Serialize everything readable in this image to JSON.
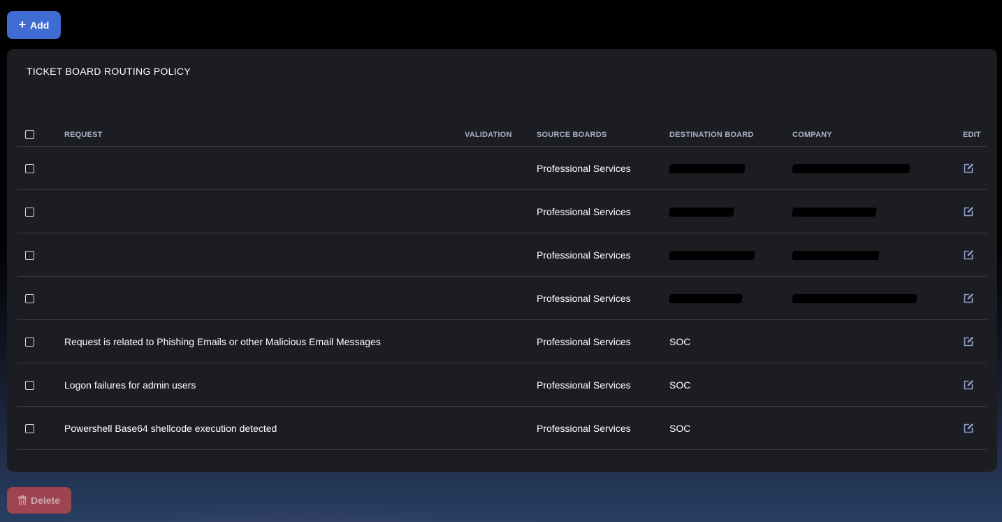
{
  "toolbar": {
    "add_label": "Add",
    "add_icon": "plus-icon",
    "delete_label": "Delete",
    "delete_icon": "trash-icon"
  },
  "panel": {
    "title": "TICKET BOARD ROUTING POLICY"
  },
  "table": {
    "headers": {
      "request": "REQUEST",
      "validation": "VALIDATION",
      "source_boards": "SOURCE BOARDS",
      "destination_board": "DESTINATION BOARD",
      "company": "COMPANY",
      "edit": "EDIT"
    },
    "rows": [
      {
        "request": "",
        "validation": "",
        "source_boards": "Professional Services",
        "destination_board": "",
        "company": "",
        "destination_redacted": true,
        "company_redacted": true
      },
      {
        "request": "",
        "validation": "",
        "source_boards": "Professional Services",
        "destination_board": "",
        "company": "",
        "destination_redacted": true,
        "company_redacted": true
      },
      {
        "request": "",
        "validation": "",
        "source_boards": "Professional Services",
        "destination_board": "",
        "company": "",
        "destination_redacted": true,
        "company_redacted": true
      },
      {
        "request": "",
        "validation": "",
        "source_boards": "Professional Services",
        "destination_board": "",
        "company": "",
        "destination_redacted": true,
        "company_redacted": true
      },
      {
        "request": "Request is related to Phishing Emails or other Malicious Email Messages",
        "validation": "",
        "source_boards": "Professional Services",
        "destination_board": "SOC",
        "company": ""
      },
      {
        "request": "Logon failures for admin users",
        "validation": "",
        "source_boards": "Professional Services",
        "destination_board": "SOC",
        "company": ""
      },
      {
        "request": "Powershell Base64 shellcode execution detected",
        "validation": "",
        "source_boards": "Professional Services",
        "destination_board": "SOC",
        "company": ""
      }
    ]
  },
  "colors": {
    "accent": "#3f6bd2",
    "danger": "#b4474f",
    "panel": "#1c1d23",
    "edit_icon": "#8e9ecb"
  }
}
